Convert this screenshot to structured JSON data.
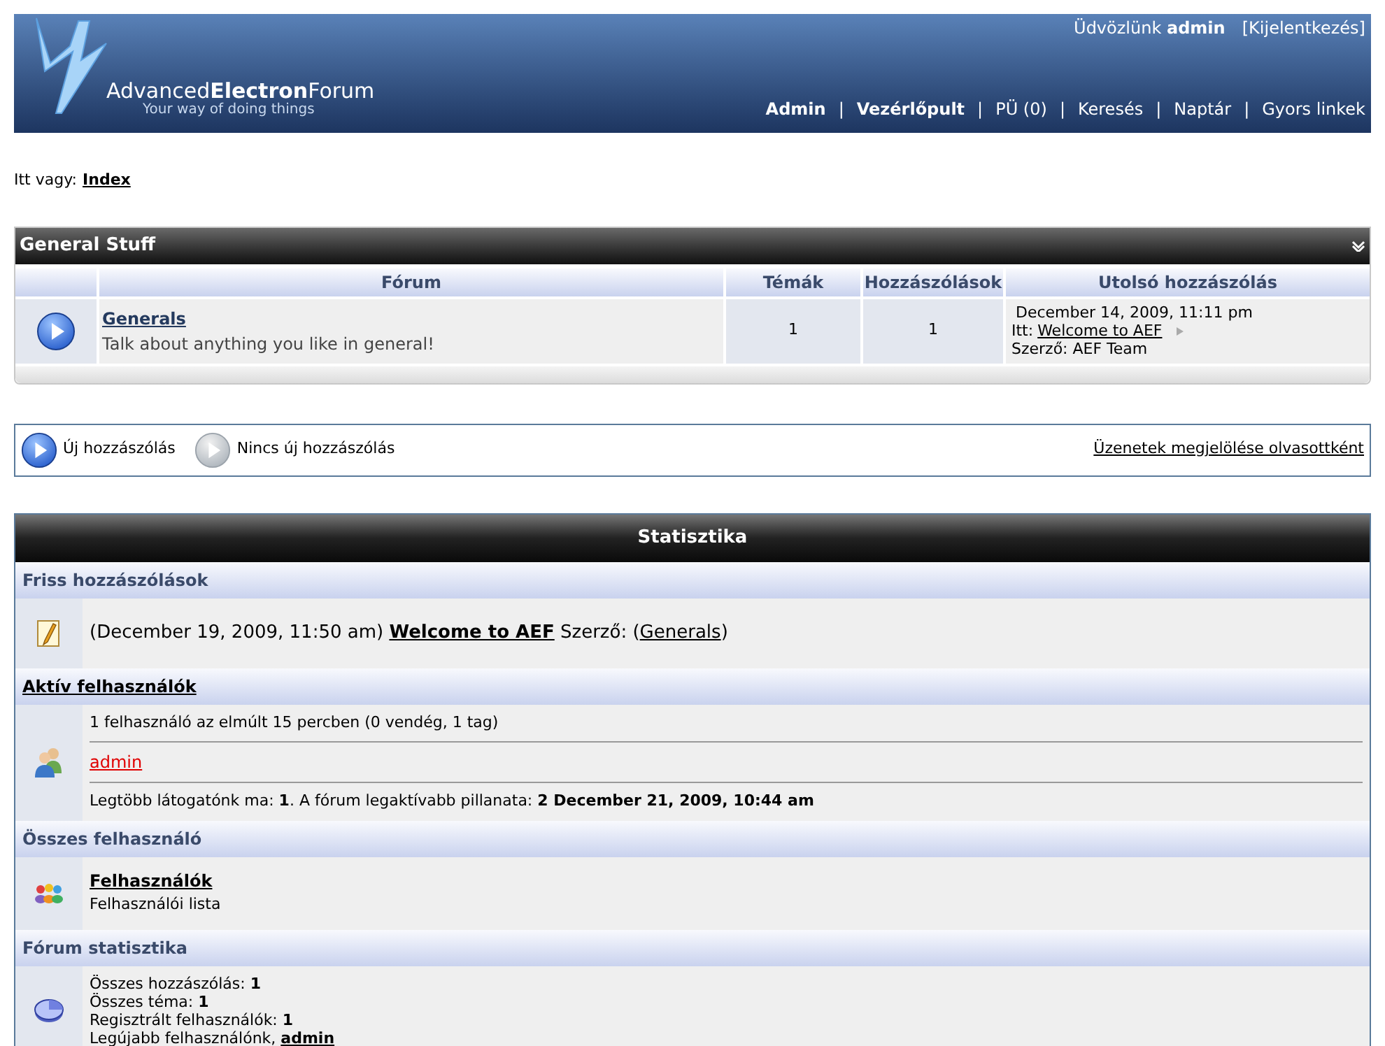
{
  "header": {
    "logo": {
      "first": "Advanced",
      "second": "Electron",
      "third": "Forum",
      "tagline": "Your way of doing things"
    },
    "welcome": "Üdvözlünk **admin**",
    "logout": "[Kijelentkezés]",
    "nav": [
      {
        "kind": "link",
        "label": "Admin",
        "bold": true
      },
      {
        "kind": "separator",
        "label": "|"
      },
      {
        "kind": "link",
        "label": "Vezérlőpult",
        "bold": true
      },
      {
        "kind": "separator",
        "label": "|"
      },
      {
        "kind": "link",
        "label": "PÜ (0)",
        "bold": false
      },
      {
        "kind": "separator",
        "label": "|"
      },
      {
        "kind": "link",
        "label": "Keresés",
        "bold": false
      },
      {
        "kind": "separator",
        "label": "|"
      },
      {
        "kind": "link",
        "label": "Naptár",
        "bold": false
      },
      {
        "kind": "separator",
        "label": "|"
      },
      {
        "kind": "link",
        "label": "Gyors linkek",
        "bold": false
      }
    ]
  },
  "breadcrumb": {
    "label": "Itt vagy:",
    "current": "Index"
  },
  "category": {
    "title": "General Stuff",
    "columns": [
      "Fórum",
      "Témák",
      "Hozzászólások",
      "Utolsó hozzászólás"
    ],
    "forums": [
      {
        "unread": true,
        "name": "Generals",
        "description": "Talk about anything you like in general!",
        "topics": "1",
        "posts": "1",
        "last_date": "December 14, 2009, 11:11 pm",
        "last_in_label": "Itt:",
        "last_topic": "Welcome to AEF",
        "last_by": "Szerző: AEF Team"
      }
    ]
  },
  "legend": {
    "items": [
      {
        "unread": true,
        "label": "Új hozzászólás"
      },
      {
        "unread": false,
        "label": "Nincs új hozzászólás"
      }
    ],
    "mark_read": "Üzenetek megjelölése olvasottként"
  },
  "stats": {
    "title": "Statisztika",
    "sections": [
      {
        "kind": "recent",
        "heading": "Friss hozzászólások",
        "heading_link": false,
        "prefix": "(December 19, 2009, 11:50 am)",
        "topic": "Welcome to AEF",
        "middle": "Szerző: (",
        "forum": "Generals",
        "suffix": ")"
      },
      {
        "kind": "online",
        "heading": "Aktív felhasználók",
        "heading_link": true,
        "summary": "1 felhasználó az elmúlt 15 percben (0 vendég, 1 tag)",
        "users": [
          "admin"
        ],
        "record": "Legtöbb látogatónk ma: **1**. A fórum legaktívabb pillanata: **2 December 21, 2009, 10:44 am**"
      },
      {
        "kind": "members",
        "heading": "Összes felhasználó",
        "heading_link": false,
        "link": "Felhasználók",
        "description": "Felhasználói lista"
      },
      {
        "kind": "forumstats",
        "heading": "Fórum statisztika",
        "heading_link": false,
        "lines": [
          "Összes hozzászólás: **1**",
          "Összes téma: **1**",
          "Regisztrált felhasználók: **1**"
        ],
        "newest_label": "Legújabb felhasználónk,",
        "newest": "admin"
      }
    ]
  }
}
